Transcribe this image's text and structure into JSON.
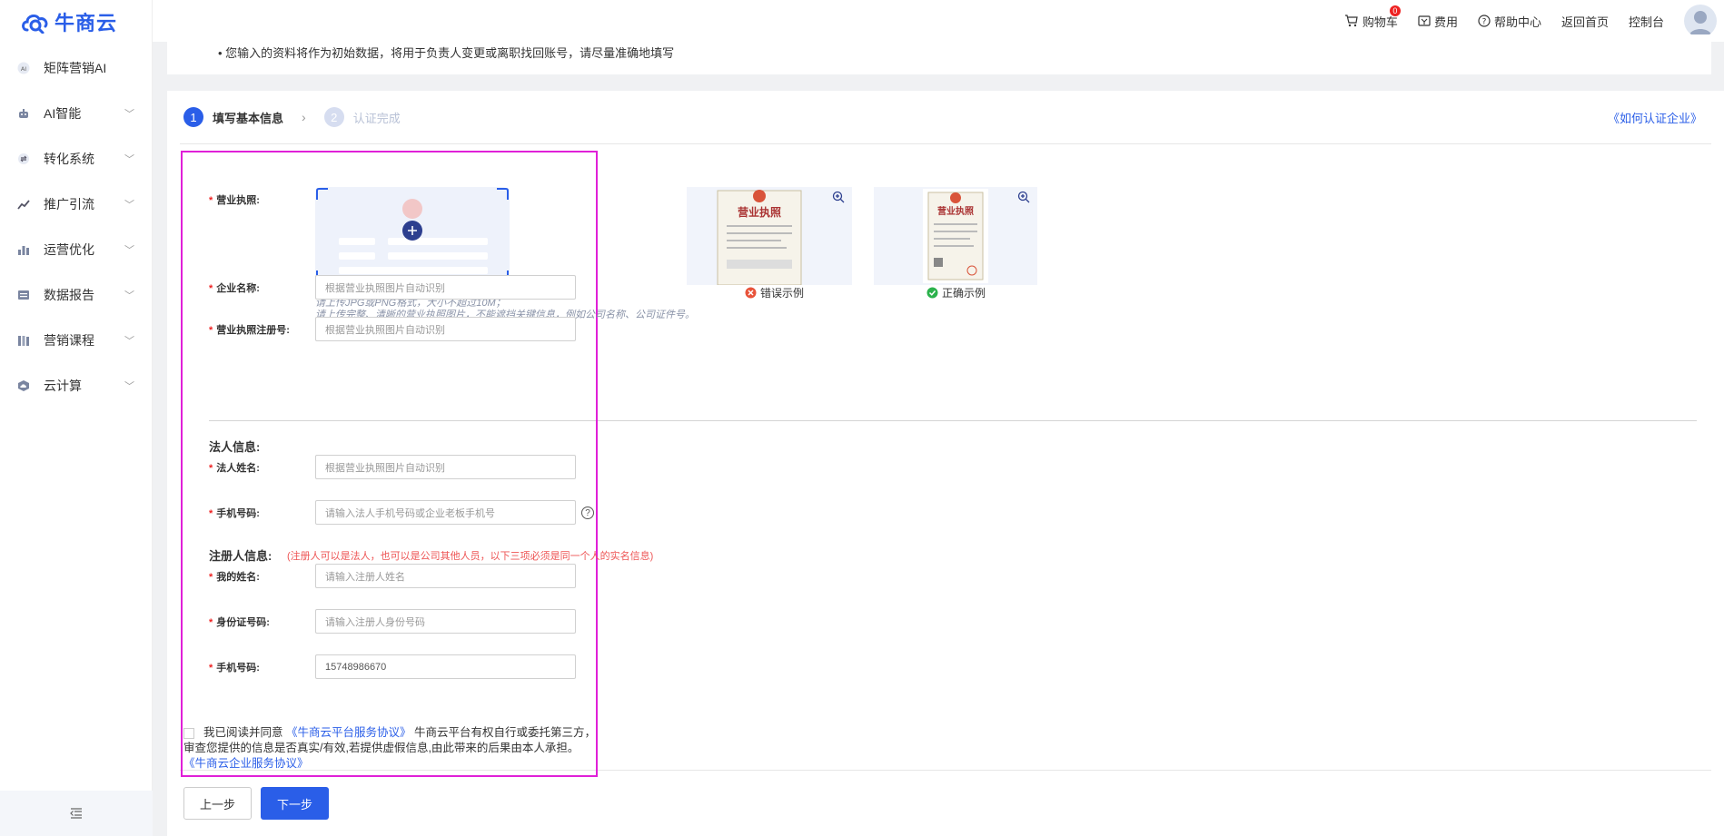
{
  "brand": {
    "logo_text": "牛商云"
  },
  "sidebar": {
    "items": [
      {
        "label": "矩阵营销AI",
        "icon": "ai-badge-icon"
      },
      {
        "label": "AI智能",
        "icon": "robot-icon"
      },
      {
        "label": "转化系统",
        "icon": "exchange-icon"
      },
      {
        "label": "推广引流",
        "icon": "trend-icon"
      },
      {
        "label": "运营优化",
        "icon": "bar-chart-icon"
      },
      {
        "label": "数据报告",
        "icon": "report-icon"
      },
      {
        "label": "营销课程",
        "icon": "books-icon"
      },
      {
        "label": "云计算",
        "icon": "cloud-icon"
      }
    ],
    "collapse_icon": "collapse-menu-icon"
  },
  "topbar": {
    "cart_label": "购物车",
    "cart_count": "0",
    "fee_label": "费用",
    "help_label": "帮助中心",
    "home_label": "返回首页",
    "console_label": "控制台"
  },
  "notice": {
    "text": "• 您输入的资料将作为初始数据，将用于负责人变更或离职找回账号，请尽量准确地填写"
  },
  "steps": [
    {
      "num": "1",
      "label": "填写基本信息"
    },
    {
      "num": "2",
      "label": "认证完成"
    }
  ],
  "how_link": "《如何认证企业》",
  "form": {
    "license_label": "营业执照:",
    "upload_hint_1": "请上传JPG或PNG格式，大小不超过10M；",
    "upload_hint_2": "请上传完整、清晰的营业执照图片，不能遮挡关键信息，例如公司名称、公司证件号。",
    "wrong_example": "错误示例",
    "right_example": "正确示例",
    "company_label": "企业名称:",
    "company_placeholder": "根据营业执照图片自动识别",
    "reg_label": "营业执照注册号:",
    "reg_placeholder": "根据营业执照图片自动识别",
    "legal_section": "法人信息:",
    "legal_name_label": "法人姓名:",
    "legal_name_placeholder": "根据营业执照图片自动识别",
    "legal_phone_label": "手机号码:",
    "legal_phone_placeholder": "请输入法人手机号码或企业老板手机号",
    "registrant_section": "注册人信息:",
    "registrant_note": "(注册人可以是法人，也可以是公司其他人员，以下三项必须是同一个人的实名信息)",
    "my_name_label": "我的姓名:",
    "my_name_placeholder": "请输入注册人姓名",
    "id_label": "身份证号码:",
    "id_placeholder": "请输入注册人身份号码",
    "phone_label": "手机号码:",
    "phone_value": "15748986670"
  },
  "agreement": {
    "prefix": "我已阅读并同意",
    "link1": "《牛商云平台服务协议》",
    "middle": "牛商云平台有权自行或委托第三方，审查您提供的信息是否真实/有效,若提供虚假信息,由此带来的后果由本人承担。",
    "link2": "《牛商云企业服务协议》"
  },
  "buttons": {
    "prev": "上一步",
    "next": "下一步"
  },
  "colors": {
    "accent": "#2a5ee8",
    "highlight": "#e020d8",
    "error": "#e22"
  }
}
